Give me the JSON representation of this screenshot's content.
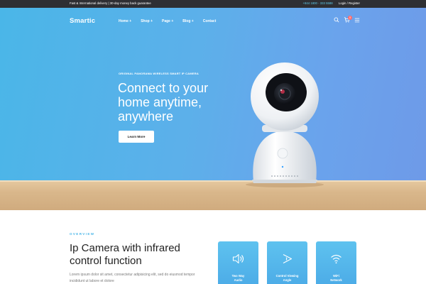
{
  "topbar": {
    "left_text": "Fast & International delivery  |  30-day money back guarantee",
    "phone": "+844 1800 - 333 5588",
    "account": "Login / Register"
  },
  "header": {
    "logo": "Smartic",
    "nav": [
      "Home +",
      "Shop +",
      "Page +",
      "Blog +",
      "Contact"
    ],
    "cart_count": "0",
    "icons": [
      "search-icon",
      "cart-icon",
      "menu-icon"
    ]
  },
  "hero": {
    "eyebrow": "ORIGINAL PANORAMA WIRELESS SMART IP CAMERA",
    "headline": "Connect to your home anytime, anywhere",
    "cta": "Learn More"
  },
  "overview": {
    "label": "OVERVIEW",
    "title": "Ip Camera with infrared control function",
    "body": "Lorem ipsum dolor sit amet, consectetur adipisicing elit, sed do eiusmod tempor incididunt ut labore et dolore",
    "features": [
      {
        "label": "Two Way\nAudio",
        "icon": "speaker-icon"
      },
      {
        "label": "Control Viewing\nAngle",
        "icon": "angle-icon"
      },
      {
        "label": "WiFi\nNetwork",
        "icon": "wifi-icon"
      }
    ]
  },
  "colors": {
    "accent": "#4ab6e8",
    "topbar": "#2e2f33",
    "hero_start": "#4ab6e8",
    "hero_end": "#6e9ae8",
    "shelf": "#d9b78b"
  }
}
